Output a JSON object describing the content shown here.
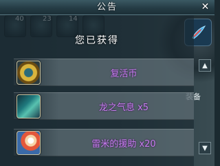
{
  "dialog": {
    "title": "公告",
    "close_label": "✕",
    "subtitle": "您已获得"
  },
  "items": [
    {
      "name": "复活币",
      "icon": "gold-coin-icon"
    },
    {
      "name": "龙之气息 x5",
      "icon": "dragon-breath-icon"
    },
    {
      "name": "雷米的援助 x20",
      "icon": "remy-aid-icon"
    }
  ],
  "background": {
    "slot_counts": [
      "40",
      "23",
      "14"
    ],
    "side_label": "装备",
    "scroll_up": "▲",
    "scroll_down": "▼"
  },
  "colors": {
    "item_text": "#c77ff0",
    "title_bar": "#253c45"
  }
}
